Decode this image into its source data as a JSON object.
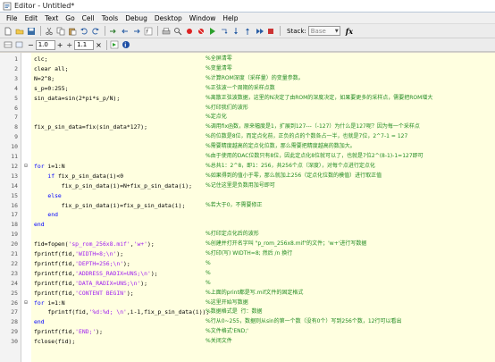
{
  "window": {
    "title": "Editor - Untitled*"
  },
  "menu": [
    "File",
    "Edit",
    "Text",
    "Go",
    "Cell",
    "Tools",
    "Debug",
    "Desktop",
    "Window",
    "Help"
  ],
  "toolbar": {
    "stack_label": "Stack:",
    "stack_value": "Base",
    "fx_label": "fx"
  },
  "cellbar": {
    "minus_sign": "−",
    "value1": "1.0",
    "plus_sign": "+",
    "divide_sign": "÷",
    "value2": "1.1",
    "times_sign": "×"
  },
  "editor": {
    "lines": [
      {
        "num": "1",
        "fold": "",
        "code": [
          {
            "t": "clc;"
          }
        ],
        "comment": "%全屏清零"
      },
      {
        "num": "2",
        "fold": "",
        "code": [
          {
            "t": "clear all;"
          }
        ],
        "comment": "%变量清零"
      },
      {
        "num": "3",
        "fold": "",
        "code": [
          {
            "t": "N=2^8;"
          }
        ],
        "comment": "%计算ROM深度（采样量）的变量参数。"
      },
      {
        "num": "4",
        "fold": "",
        "code": [
          {
            "t": "s_p=0:255;"
          }
        ],
        "comment": "%正弦波一个周期的采样点数"
      },
      {
        "num": "5",
        "fold": "",
        "code": [
          {
            "t": "sin_data=sin(2*pi*s_p/N);"
          }
        ],
        "comment": "%离散正弦波数据，这里的N决定了由ROM的深度决定，如果要更多的采样点，需要把ROM增大"
      },
      {
        "num": "6",
        "fold": "",
        "code": [],
        "comment": "%打印我们的波形"
      },
      {
        "num": "7",
        "fold": "",
        "code": [],
        "comment": "%定点化"
      },
      {
        "num": "8",
        "fold": "",
        "code": [
          {
            "t": "fix_p_sin_data=fix(sin_data*127);"
          }
        ],
        "comment": "%调用fix函数，原来幅度是1，扩展到127---（-127）为什么是127呢？因为每一个采样点"
      },
      {
        "num": "9",
        "fold": "",
        "code": [],
        "comment": "%的位数是8位，而定点化前，正负的点的个数各占一半，也就是7位，2^7-1 = 127"
      },
      {
        "num": "10",
        "fold": "",
        "code": [],
        "comment": "%需要精度越高的定点化位数，那么需要把精度越高的数加大。"
      },
      {
        "num": "11",
        "fold": "",
        "code": [],
        "comment": "%由于使用的DAC位数只有8位，因此定点化8位就可以了，也就是7位2^(8-1)-1=127即可"
      },
      {
        "num": "12",
        "fold": "⊟",
        "code": [
          {
            "t": "for ",
            "k": 1
          },
          {
            "t": "i=1:N"
          }
        ],
        "comment": "%总共1：2^8，即1：256，共256个点（深度），对每个点进行定点化"
      },
      {
        "num": "13",
        "fold": "",
        "code": [
          {
            "t": "    "
          },
          {
            "t": "if ",
            "k": 1
          },
          {
            "t": "fix_p_sin_data(i)<0"
          }
        ],
        "comment": "%如果得到的值小于零，那么就加上256（定点化位数的模值）进行取正值"
      },
      {
        "num": "14",
        "fold": "",
        "code": [
          {
            "t": "        fix_p_sin_data(i)=N+fix_p_sin_data(i);"
          }
        ],
        "comment": "%记住这里是负数用加号即可"
      },
      {
        "num": "15",
        "fold": "",
        "code": [
          {
            "t": "    "
          },
          {
            "t": "else",
            "k": 1
          }
        ],
        "comment": ""
      },
      {
        "num": "16",
        "fold": "",
        "code": [
          {
            "t": "        fix_p_sin_data(i)=fix_p_sin_data(i);"
          }
        ],
        "comment": "%若大于0，不需要修正"
      },
      {
        "num": "17",
        "fold": "",
        "code": [
          {
            "t": "    "
          },
          {
            "t": "end",
            "k": 1
          }
        ],
        "comment": ""
      },
      {
        "num": "18",
        "fold": "",
        "code": [
          {
            "t": "end",
            "k": 1
          }
        ],
        "comment": ""
      },
      {
        "num": "19",
        "fold": "",
        "code": [],
        "comment": "%打印定点化后的波形"
      },
      {
        "num": "20",
        "fold": "",
        "code": [
          {
            "t": "fid=fopen("
          },
          {
            "t": "'sp_rom_256x8.mif'",
            "s": 1
          },
          {
            "t": ","
          },
          {
            "t": "'w+'",
            "s": 1
          },
          {
            "t": ");"
          }
        ],
        "comment": "%创建并打开名字叫 \"p_rom_256x8.mif\"的文件；'w+'进行写数据"
      },
      {
        "num": "21",
        "fold": "",
        "code": [
          {
            "t": "fprintf(fid,"
          },
          {
            "t": "'WIDTH=8;\\n'",
            "s": 1
          },
          {
            "t": ");"
          }
        ],
        "comment": "%打印(写) WIDTH=8; 然后 /n 换行"
      },
      {
        "num": "22",
        "fold": "",
        "code": [
          {
            "t": "fprintf(fid,"
          },
          {
            "t": "'DEPTH=256;\\n'",
            "s": 1
          },
          {
            "t": ");"
          }
        ],
        "comment": "%"
      },
      {
        "num": "23",
        "fold": "",
        "code": [
          {
            "t": "fprintf(fid,"
          },
          {
            "t": "'ADDRESS_RADIX=UNS;\\n'",
            "s": 1
          },
          {
            "t": ");"
          }
        ],
        "comment": "%"
      },
      {
        "num": "24",
        "fold": "",
        "code": [
          {
            "t": "fprintf(fid,"
          },
          {
            "t": "'DATA_RADIX=UNS;\\n'",
            "s": 1
          },
          {
            "t": ");"
          }
        ],
        "comment": "%"
      },
      {
        "num": "25",
        "fold": "",
        "code": [
          {
            "t": "fprintf(fid,"
          },
          {
            "t": "'CONTENT BEGIN'",
            "s": 1
          },
          {
            "t": ");"
          }
        ],
        "comment": "%上面的print都是写.mif文件的固定格式"
      },
      {
        "num": "26",
        "fold": "⊟",
        "code": [
          {
            "t": "for ",
            "k": 1
          },
          {
            "t": "i=1:N"
          }
        ],
        "comment": "%这里开始写数据"
      },
      {
        "num": "27",
        "fold": "",
        "code": [
          {
            "t": "    fprintf(fid,"
          },
          {
            "t": "'%d:%d; \\n'",
            "s": 1
          },
          {
            "t": ",i-1,fix_p_sin_data(i));"
          }
        ],
        "comment": "%数据格式是  行：数据"
      },
      {
        "num": "28",
        "fold": "",
        "code": [
          {
            "t": "end",
            "k": 1
          }
        ],
        "comment": "%行从0~255，数据则从sin的第一个数（没有0个）写到256个数，12行可以看出"
      },
      {
        "num": "29",
        "fold": "",
        "code": [
          {
            "t": "fprintf(fid,"
          },
          {
            "t": "'END;'",
            "s": 1
          },
          {
            "t": ");"
          }
        ],
        "comment": "%文件格式'END;'"
      },
      {
        "num": "30",
        "fold": "",
        "code": [
          {
            "t": "fclose(fid);"
          }
        ],
        "comment": "%关闭文件"
      }
    ]
  }
}
